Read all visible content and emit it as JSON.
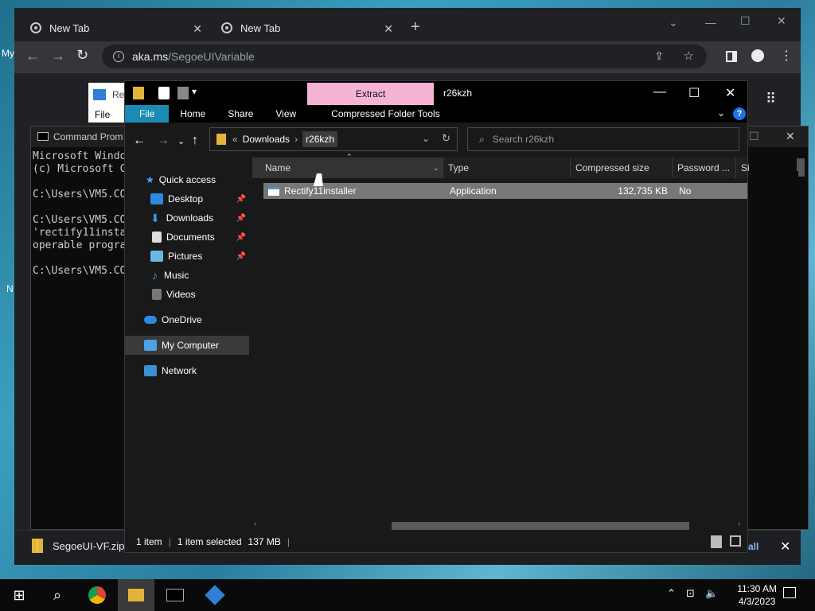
{
  "desktop": {
    "frag_my": "My",
    "frag_n": "N"
  },
  "chrome": {
    "tabs": [
      {
        "label": "New Tab"
      },
      {
        "label": "New Tab"
      }
    ],
    "new_tab_icon": "+",
    "address_host": "aka.ms",
    "address_path": "/SegoeUIVariable",
    "download": {
      "filename": "SegoeUI-VF.zip",
      "show_all": "all"
    }
  },
  "wordpad": {
    "file_tab": "File",
    "title_frag": "Re"
  },
  "cmd": {
    "title": "Command Prom",
    "lines": "Microsoft Windo\n(c) Microsoft C\n\nC:\\Users\\VM5.CO\n\nC:\\Users\\VM5.CO\n'rectify11insta\noperable progra\n\nC:\\Users\\VM5.CO"
  },
  "explorer": {
    "contextual_tab": "Extract",
    "title": "r26kzh",
    "ribbon": {
      "file": "File",
      "home": "Home",
      "share": "Share",
      "view": "View",
      "tools": "Compressed Folder Tools"
    },
    "breadcrumb": {
      "sep": "«",
      "parent": "Downloads",
      "arrow": "›",
      "current": "r26kzh"
    },
    "search_placeholder": "Search r26kzh",
    "sidebar": [
      {
        "label": "Quick access",
        "icon": "star-icon"
      },
      {
        "label": "Desktop",
        "icon": "desktop-icon",
        "pinned": true
      },
      {
        "label": "Downloads",
        "icon": "downloads-icon",
        "pinned": true
      },
      {
        "label": "Documents",
        "icon": "documents-icon",
        "pinned": true
      },
      {
        "label": "Pictures",
        "icon": "pictures-icon",
        "pinned": true
      },
      {
        "label": "Music",
        "icon": "music-icon"
      },
      {
        "label": "Videos",
        "icon": "videos-icon"
      },
      {
        "label": "OneDrive",
        "icon": "cloud-icon"
      },
      {
        "label": "My Computer",
        "icon": "computer-icon",
        "selected": true
      },
      {
        "label": "Network",
        "icon": "network-icon"
      }
    ],
    "columns": {
      "name": "Name",
      "type": "Type",
      "size": "Compressed size",
      "password": "Password ...",
      "extra": "Si"
    },
    "files": [
      {
        "name": "Rectify11installer",
        "type": "Application",
        "size": "132,735 KB",
        "password": "No"
      }
    ],
    "status": {
      "count": "1 item",
      "selected": "1 item selected",
      "size": "137 MB"
    }
  },
  "taskbar": {
    "time": "11:30 AM",
    "date": "4/3/2023"
  },
  "colors": {
    "ribbon_file": "#1a8bb3",
    "extract_tab": "#f5b4d4",
    "selection": "#777777"
  }
}
